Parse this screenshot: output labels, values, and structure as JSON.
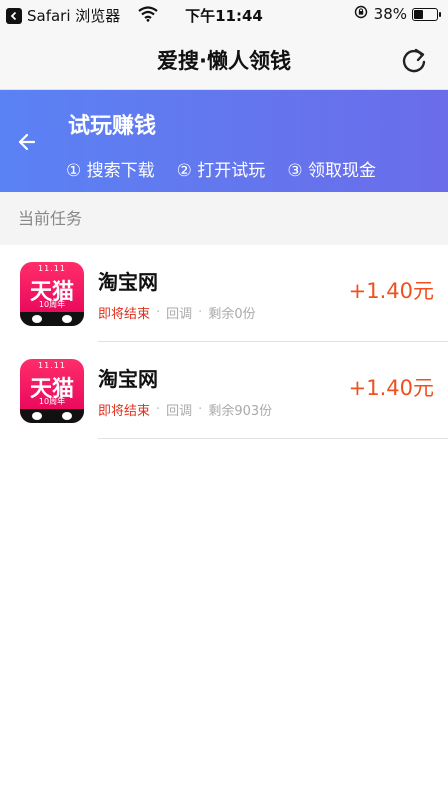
{
  "status_bar": {
    "back_app": "Safari 浏览器",
    "time": "下午11:44",
    "battery": "38%"
  },
  "header": {
    "title": "爱搜·懒人领钱"
  },
  "banner": {
    "title": "试玩赚钱",
    "steps": [
      "① 搜索下载",
      "② 打开试玩",
      "③ 领取现金"
    ]
  },
  "section": {
    "title": "当前任务"
  },
  "tasks": [
    {
      "icon_label_top": "11.11",
      "icon_label_main": "天猫",
      "icon_label_sub": "10周年",
      "name": "淘宝网",
      "status": "即将结束",
      "type": "回调",
      "remaining": "剩余0份",
      "reward": "+1.40元"
    },
    {
      "icon_label_top": "11.11",
      "icon_label_main": "天猫",
      "icon_label_sub": "10周年",
      "name": "淘宝网",
      "status": "即将结束",
      "type": "回调",
      "remaining": "剩余903份",
      "reward": "+1.40元"
    }
  ],
  "colors": {
    "banner_start": "#5a82f4",
    "banner_end": "#6a6cea",
    "reward": "#f0501e",
    "status_ending": "#e0301e"
  }
}
